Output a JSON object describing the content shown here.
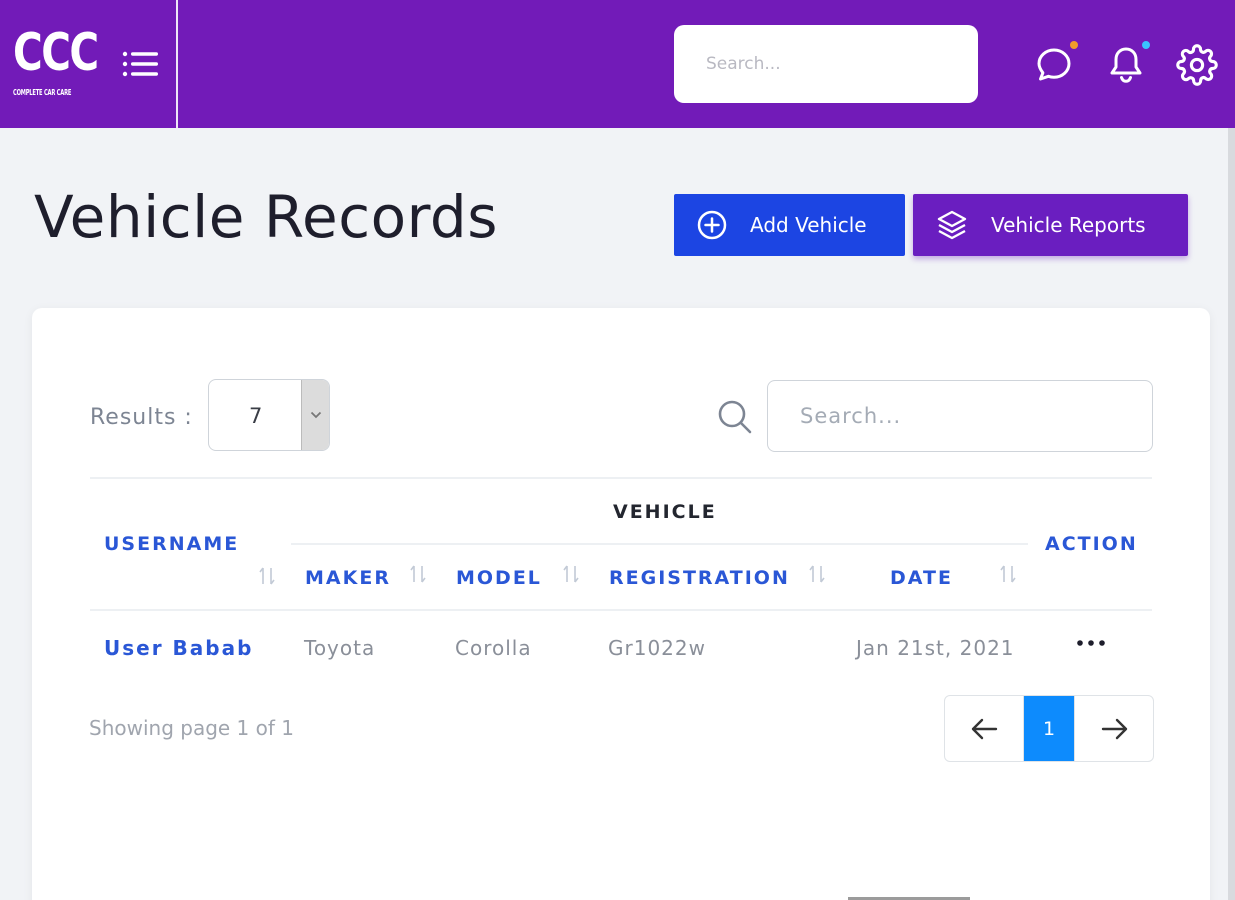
{
  "brand": {
    "logo_text": "CCC",
    "logo_tagline": "COMPLETE CAR CARE"
  },
  "header": {
    "search_placeholder": "Search...",
    "icons": [
      "menu-icon",
      "chat-icon",
      "bell-icon",
      "gear-icon"
    ],
    "colors": {
      "topbar": "#721bb8",
      "chat_dot": "#f29b2c",
      "bell_dot": "#39c3ff"
    }
  },
  "page": {
    "title": "Vehicle Records",
    "add_button": "Add Vehicle",
    "reports_button": "Vehicle Reports"
  },
  "card": {
    "results_label": "Results :",
    "results_value": "7",
    "search_placeholder": "Search...",
    "table": {
      "group_header": "VEHICLE",
      "columns": [
        "USERNAME",
        "MAKER",
        "MODEL",
        "REGISTRATION",
        "DATE",
        "ACTION"
      ],
      "rows": [
        {
          "username": "User Babab",
          "maker": "Toyota",
          "model": "Corolla",
          "registration": "Gr1022w",
          "date": "Jan 21st, 2021"
        }
      ]
    },
    "showing": "Showing page 1 of 1",
    "pagination": {
      "current": "1"
    }
  },
  "colors": {
    "accent_blue": "#1c45e3",
    "accent_purple": "#6a1ec0",
    "page_active": "#0d8bfd",
    "header_text": "#2a57d6"
  }
}
